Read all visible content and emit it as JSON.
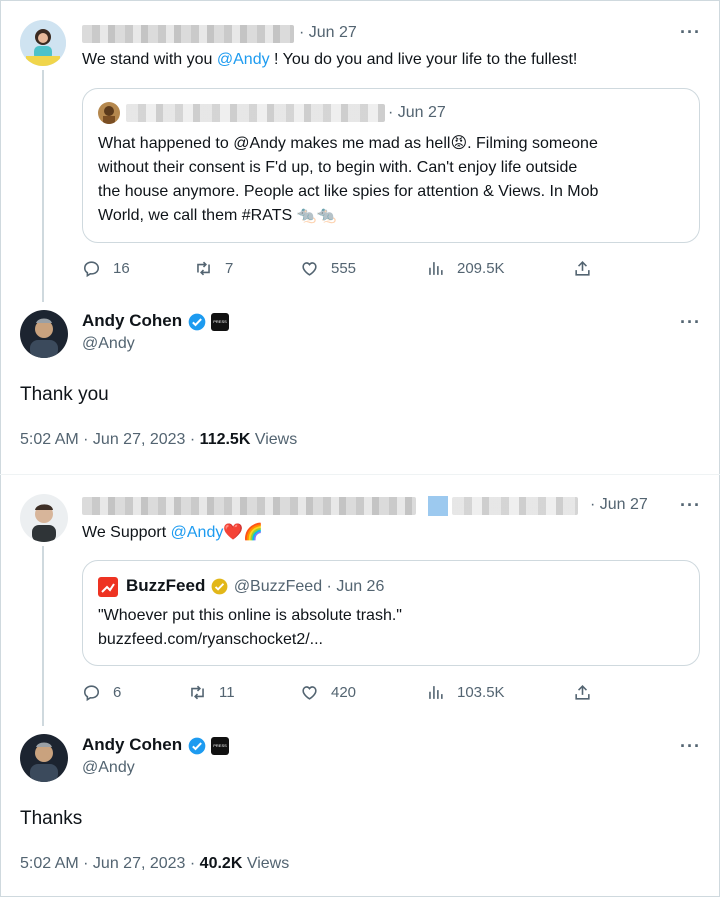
{
  "tweet1": {
    "date": "· Jun 27",
    "text_pre": "We stand with you ",
    "mention": "@Andy",
    "text_post": " ! You do you and live your life to the fullest!",
    "quote": {
      "date": "· Jun 27",
      "lines": [
        "What happened to @Andy makes me mad as hell",
        ". Filming someone",
        "without their consent is F'd up, to begin with. Can't enjoy life outside",
        "the house anymore. People act like spies for attention & Views. In Mob",
        "World, we call them #RATS"
      ],
      "emoji_angry": "😡",
      "emoji_rats": "🐀🐀"
    },
    "replies": "16",
    "retweets": "7",
    "likes": "555",
    "views": "209.5K"
  },
  "reply1": {
    "name": "Andy Cohen",
    "handle": "@Andy",
    "badge": "PRESS",
    "text": "Thank you",
    "timestamp": "5:02 AM · Jun 27, 2023 · ",
    "views_count": "112.5K",
    "views_label": " Views"
  },
  "tweet2": {
    "date": "· Jun 27",
    "text_pre": "We Support ",
    "mention": "@Andy",
    "emoji": "❤️🌈",
    "quote": {
      "name": "BuzzFeed",
      "handle_date": "@BuzzFeed · Jun 26",
      "text": "\"Whoever put this online is absolute trash.\"",
      "link": "buzzfeed.com/ryanschocket2/..."
    },
    "replies": "6",
    "retweets": "11",
    "likes": "420",
    "views": "103.5K"
  },
  "reply2": {
    "name": "Andy Cohen",
    "handle": "@Andy",
    "badge": "PRESS",
    "text": "Thanks",
    "timestamp": "5:02 AM · Jun 27, 2023 · ",
    "views_count": "40.2K",
    "views_label": " Views"
  },
  "more_label": "···",
  "colors": {
    "link": "#1d9bf0",
    "secondary": "#536471",
    "border": "#cfd9de",
    "verified": "#1d9bf0",
    "gold": "#e2b719",
    "heart": "#e0245e"
  }
}
